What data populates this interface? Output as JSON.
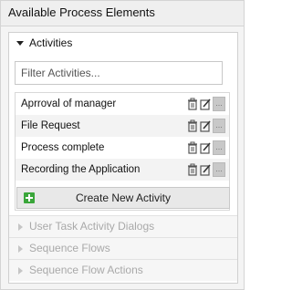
{
  "panel": {
    "title": "Available Process Elements"
  },
  "activities": {
    "title": "Activities",
    "filter_placeholder": "Filter Activities...",
    "items": [
      {
        "label": "Aprroval of manager"
      },
      {
        "label": "File Request"
      },
      {
        "label": "Process complete"
      },
      {
        "label": "Recording the Application"
      }
    ],
    "more_label": "...",
    "create_label": "Create New Activity"
  },
  "sections": [
    {
      "label": "User Task Activity Dialogs"
    },
    {
      "label": "Sequence Flows"
    },
    {
      "label": "Sequence Flow Actions"
    }
  ],
  "colors": {
    "create_icon": "#3aa63a",
    "collapsed_text": "#a9a9a9"
  }
}
